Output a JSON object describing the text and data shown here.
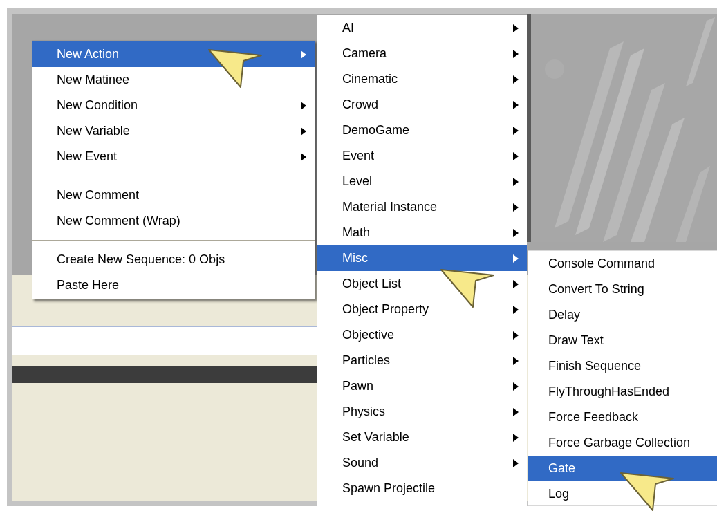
{
  "context_menu": {
    "items": [
      {
        "kind": "item",
        "label": "New Action",
        "has_submenu": true,
        "selected": true
      },
      {
        "kind": "item",
        "label": "New Matinee",
        "has_submenu": false,
        "selected": false
      },
      {
        "kind": "item",
        "label": "New Condition",
        "has_submenu": true,
        "selected": false
      },
      {
        "kind": "item",
        "label": "New Variable",
        "has_submenu": true,
        "selected": false
      },
      {
        "kind": "item",
        "label": "New Event",
        "has_submenu": true,
        "selected": false
      },
      {
        "kind": "separator"
      },
      {
        "kind": "item",
        "label": "New Comment",
        "has_submenu": false,
        "selected": false
      },
      {
        "kind": "item",
        "label": "New Comment (Wrap)",
        "has_submenu": false,
        "selected": false
      },
      {
        "kind": "separator"
      },
      {
        "kind": "item",
        "label": "Create New Sequence: 0 Objs",
        "has_submenu": false,
        "selected": false
      },
      {
        "kind": "item",
        "label": "Paste Here",
        "has_submenu": false,
        "selected": false
      }
    ]
  },
  "action_submenu": {
    "items": [
      {
        "label": "AI",
        "has_submenu": true,
        "selected": false
      },
      {
        "label": "Camera",
        "has_submenu": true,
        "selected": false
      },
      {
        "label": "Cinematic",
        "has_submenu": true,
        "selected": false
      },
      {
        "label": "Crowd",
        "has_submenu": true,
        "selected": false
      },
      {
        "label": "DemoGame",
        "has_submenu": true,
        "selected": false
      },
      {
        "label": "Event",
        "has_submenu": true,
        "selected": false
      },
      {
        "label": "Level",
        "has_submenu": true,
        "selected": false
      },
      {
        "label": "Material Instance",
        "has_submenu": true,
        "selected": false
      },
      {
        "label": "Math",
        "has_submenu": true,
        "selected": false
      },
      {
        "label": "Misc",
        "has_submenu": true,
        "selected": true
      },
      {
        "label": "Object List",
        "has_submenu": true,
        "selected": false
      },
      {
        "label": "Object Property",
        "has_submenu": true,
        "selected": false
      },
      {
        "label": "Objective",
        "has_submenu": true,
        "selected": false
      },
      {
        "label": "Particles",
        "has_submenu": true,
        "selected": false
      },
      {
        "label": "Pawn",
        "has_submenu": true,
        "selected": false
      },
      {
        "label": "Physics",
        "has_submenu": true,
        "selected": false
      },
      {
        "label": "Set Variable",
        "has_submenu": true,
        "selected": false
      },
      {
        "label": "Sound",
        "has_submenu": true,
        "selected": false
      },
      {
        "label": "Spawn Projectile",
        "has_submenu": false,
        "selected": false
      }
    ]
  },
  "misc_submenu": {
    "items": [
      {
        "label": "Console Command",
        "selected": false
      },
      {
        "label": "Convert To String",
        "selected": false
      },
      {
        "label": "Delay",
        "selected": false
      },
      {
        "label": "Draw Text",
        "selected": false
      },
      {
        "label": "Finish Sequence",
        "selected": false
      },
      {
        "label": "FlyThroughHasEnded",
        "selected": false
      },
      {
        "label": "Force Feedback",
        "selected": false
      },
      {
        "label": "Force Garbage Collection",
        "selected": false
      },
      {
        "label": "Gate",
        "selected": true
      },
      {
        "label": "Log",
        "selected": false
      }
    ]
  }
}
